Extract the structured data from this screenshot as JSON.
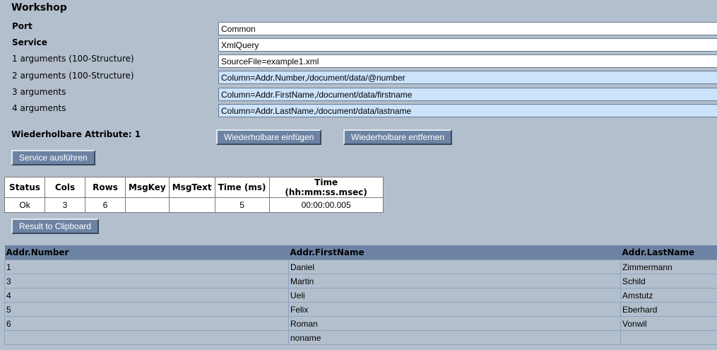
{
  "page": {
    "title": "Workshop"
  },
  "form": {
    "fields": [
      {
        "label": "Port",
        "value": "Common"
      },
      {
        "label": "Service",
        "value": "XmlQuery"
      },
      {
        "label": "1 arguments (100-Structure)",
        "value": "SourceFile=example1.xml"
      },
      {
        "label": "2 arguments (100-Structure)",
        "value": "Column=Addr.Number,/document/data/@number"
      },
      {
        "label": "3 arguments",
        "value": "Column=Addr.FirstName,/document/data/firstname"
      },
      {
        "label": "4 arguments",
        "value": "Column=Addr.LastName,/document/data/lastname"
      }
    ],
    "repeatable_label": "Wiederholbare Attribute: 1",
    "insert_button": "Wiederholbare einfügen",
    "remove_button": "Wiederholbare entfernen",
    "execute_button": "Service ausführen"
  },
  "status_table": {
    "headers": [
      "Status",
      "Cols",
      "Rows",
      "MsgKey",
      "MsgText",
      "Time (ms)",
      "Time (hh:mm:ss.msec)"
    ],
    "row": [
      "Ok",
      "3",
      "6",
      "",
      "",
      "5",
      "00:00:00.005"
    ]
  },
  "clipboard_button": "Result to Clipboard",
  "result_table": {
    "headers": [
      "Addr.Number",
      "Addr.FirstName",
      "Addr.LastName"
    ],
    "rows": [
      [
        "1",
        "Daniel",
        "Zimmermann"
      ],
      [
        "3",
        "Martin",
        "Schild"
      ],
      [
        "4",
        "Ueli",
        "Amstutz"
      ],
      [
        "5",
        "Felix",
        "Eberhard"
      ],
      [
        "6",
        "Roman",
        "Vonwil"
      ],
      [
        "",
        "noname",
        ""
      ]
    ]
  }
}
